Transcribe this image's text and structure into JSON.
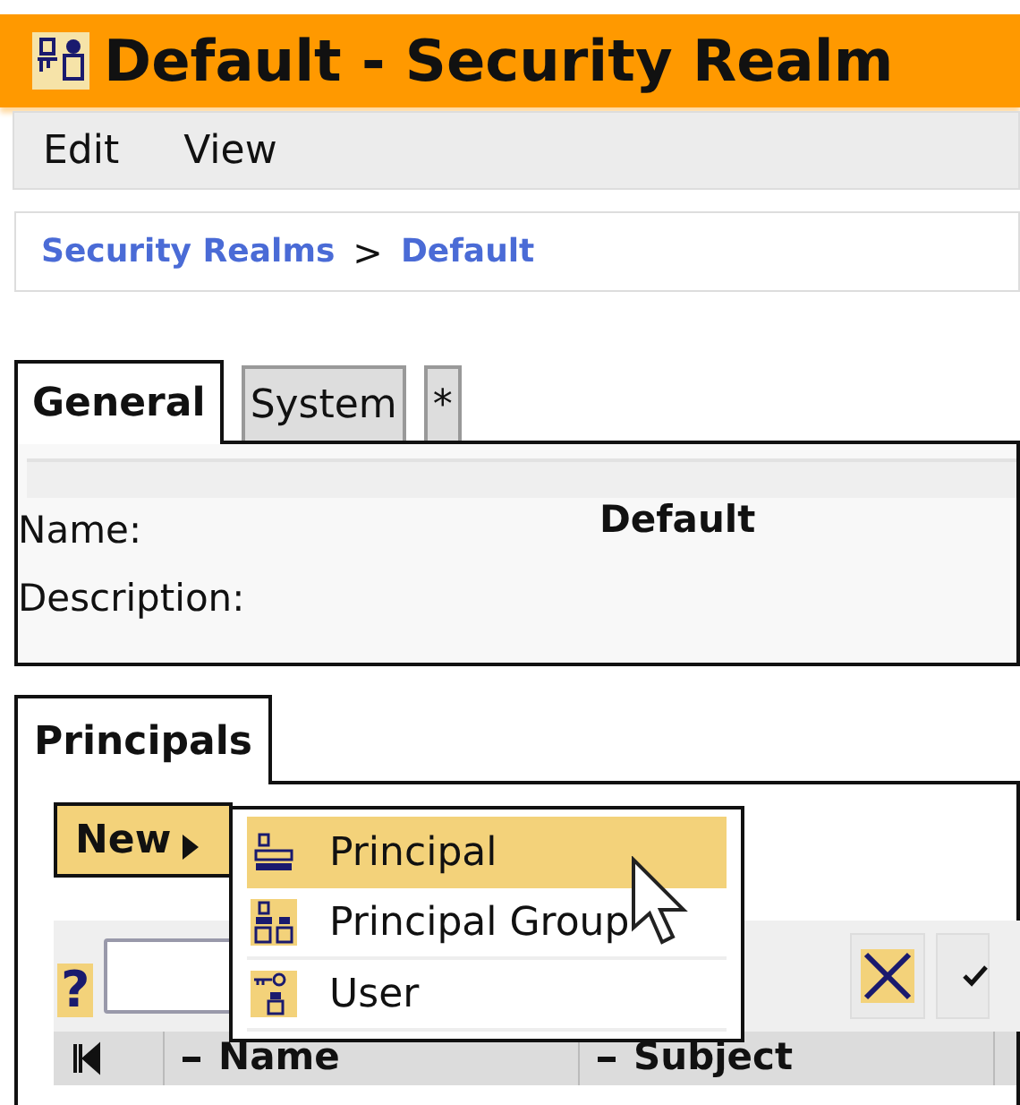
{
  "window": {
    "title": "Default - Security Realm"
  },
  "menu_bar": [
    "Edit",
    "View"
  ],
  "breadcrumb": {
    "items": [
      "Security Realms",
      "Default"
    ],
    "separator": ">"
  },
  "tabs": [
    {
      "label": "General",
      "selected": true
    },
    {
      "label": "System",
      "selected": false
    },
    {
      "label": "*",
      "selected": false
    }
  ],
  "fields": [
    {
      "label": "Name:",
      "value": "Default"
    },
    {
      "label": "Description:"
    }
  ],
  "principals": {
    "tabs": [
      {
        "label": "Principals",
        "selected": true
      }
    ],
    "new_button": "New",
    "new_menu": [
      {
        "label": "Principal",
        "selected": true
      },
      {
        "label": "Principal Group",
        "selected": false
      },
      {
        "label": "User",
        "selected": false
      }
    ],
    "help": "?",
    "columns": [
      "Name",
      "Subject"
    ]
  }
}
